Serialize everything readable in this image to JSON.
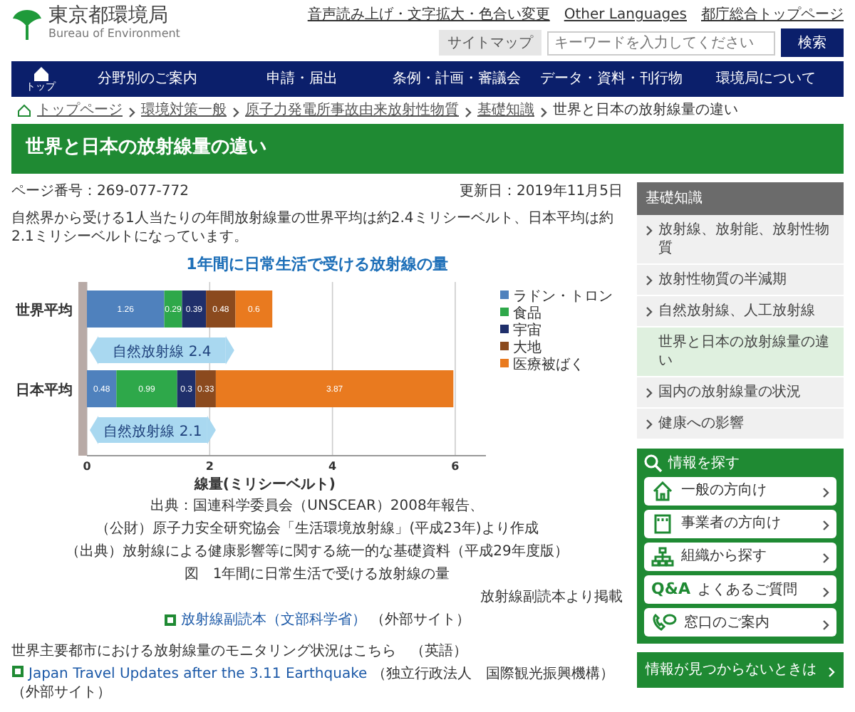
{
  "header": {
    "logo_title": "東京都環境局",
    "logo_subtitle": "Bureau of Environment",
    "top_links": [
      "音声読み上げ・文字拡大・色合い変更",
      "Other Languages",
      "都庁総合トップページ"
    ],
    "sitemap": "サイトマップ",
    "search": {
      "placeholder": "キーワードを入力してください",
      "button": "検索"
    }
  },
  "nav": {
    "home": "トップ",
    "items": [
      "分野別のご案内",
      "申請・届出",
      "条例・計画・審議会",
      "データ・資料・刊行物",
      "環境局について"
    ]
  },
  "breadcrumb": [
    "トップページ",
    "環境対策一般",
    "原子力発電所事故由来放射性物質",
    "基礎知識",
    "世界と日本の放射線量の違い"
  ],
  "page_title": "世界と日本の放射線量の違い",
  "page_number": "ページ番号：269-077-772",
  "updated": "更新日：2019年11月5日",
  "intro": "自然界から受ける1人当たりの年間放射線量の世界平均は約2.4ミリシーベルト、日本平均は約2.1ミリシーベルトになっています。",
  "figure": {
    "chart_data": {
      "type": "bar",
      "orientation": "horizontal",
      "stacked": true,
      "title": "1年間に日常生活で受ける放射線の量",
      "xlabel": "線量(ミリシーベルト)",
      "categories": [
        "世界平均",
        "日本平均"
      ],
      "series": [
        {
          "name": "ラドン・トロン",
          "color": "#4f81bd",
          "values": [
            1.26,
            0.48
          ]
        },
        {
          "name": "食品",
          "color": "#2ea84a",
          "values": [
            0.29,
            0.99
          ]
        },
        {
          "name": "宇宙",
          "color": "#1f2f6b",
          "values": [
            0.39,
            0.3
          ]
        },
        {
          "name": "大地",
          "color": "#8b4a1e",
          "values": [
            0.48,
            0.33
          ]
        },
        {
          "name": "医療被ばく",
          "color": "#e97a1f",
          "values": [
            0.6,
            3.87
          ]
        }
      ],
      "xlim": [
        0,
        6.5
      ],
      "xticks": [
        0,
        2,
        4,
        6
      ],
      "data_labels": true,
      "grid": true,
      "legend": true,
      "annotations": [
        {
          "text": "自然放射線 2.4",
          "x": 2.4,
          "y": "世界平均"
        },
        {
          "text": "自然放射線 2.1",
          "x": 2.1,
          "y": "日本平均"
        }
      ]
    },
    "sources": [
      "出典：国連科学委員会（UNSCEAR）2008年報告、",
      "（公財）原子力安全研究協会「生活環境放射線」(平成23年)より作成"
    ],
    "source_note": "（出典）放射線による健康影響等に関する統一的な基礎資料（平成29年度版）",
    "caption": "図　1年間に日常生活で受ける放射線の量"
  },
  "credit": "放射線副読本より掲載",
  "reference_link": {
    "label": "放射線副読本（文部科学省）",
    "note": "（外部サイト）"
  },
  "monitoring": {
    "text": "世界主要都市における放射線量のモニタリング状況はこちら",
    "language": "（英語）",
    "link": "Japan Travel Updates after the 3.11 Earthquake",
    "note": "（独立行政法人　国際観光振興機構）",
    "external": "（外部サイト）"
  },
  "sidebar": {
    "heading": "基礎知識",
    "items": [
      {
        "label": "放射線、放射能、放射性物質",
        "selected": false
      },
      {
        "label": "放射性物質の半減期",
        "selected": false
      },
      {
        "label": "自然放射線、人工放射線",
        "selected": false
      },
      {
        "label": "世界と日本の放射線量の違い",
        "selected": true
      },
      {
        "label": "国内の放射線量の状況",
        "selected": false
      },
      {
        "label": "健康への影響",
        "selected": false
      }
    ],
    "finder": {
      "title": "情報を探す",
      "buttons": [
        {
          "kind": "home",
          "label": "一般の方向け"
        },
        {
          "kind": "building",
          "label": "事業者の方向け"
        },
        {
          "kind": "organization",
          "label": "組織から探す"
        },
        {
          "kind": "qa",
          "badge": "Q&A",
          "label": "よくあるご質問"
        },
        {
          "kind": "phone",
          "label": "窓口のご案内"
        }
      ]
    },
    "not_found": "情報が見つからないときは"
  }
}
